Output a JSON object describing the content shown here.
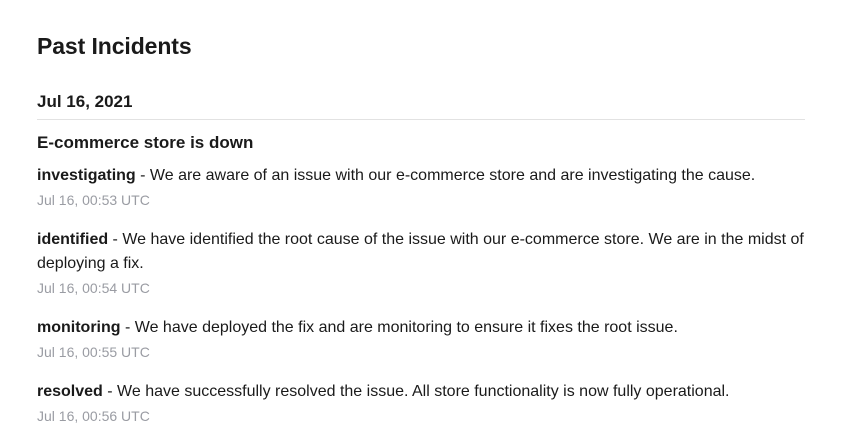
{
  "page_title": "Past Incidents",
  "day": {
    "date": "Jul 16, 2021",
    "incident": {
      "title": "E-commerce store is down",
      "separator": " - ",
      "updates": [
        {
          "status": "investigating",
          "message": "We are aware of an issue with our e-commerce store and are investigating the cause.",
          "timestamp": "Jul 16, 00:53 UTC"
        },
        {
          "status": "identified",
          "message": "We have identified the root cause of the issue with our e-commerce store. We are in the midst of deploying a fix.",
          "timestamp": "Jul 16, 00:54 UTC"
        },
        {
          "status": "monitoring",
          "message": "We have deployed the fix and are monitoring to ensure it fixes the root issue.",
          "timestamp": "Jul 16, 00:55 UTC"
        },
        {
          "status": "resolved",
          "message": "We have successfully resolved the issue. All store functionality is now fully operational.",
          "timestamp": "Jul 16, 00:56 UTC"
        }
      ]
    }
  }
}
